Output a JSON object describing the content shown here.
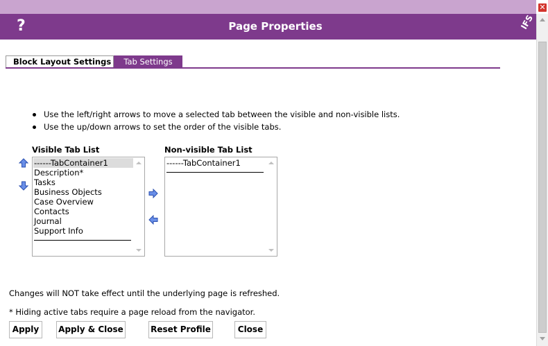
{
  "window": {
    "close_glyph": "✕",
    "title": "Page Properties",
    "help_glyph": "?",
    "logo_text": "IFS"
  },
  "tabs": [
    {
      "label": "Block Layout Settings",
      "active": false
    },
    {
      "label": "Tab Settings",
      "active": true
    }
  ],
  "instructions": [
    "Use the left/right arrows to move a selected tab between the visible and non-visible lists.",
    "Use the up/down arrows to set the order of the visible tabs."
  ],
  "visible_list": {
    "label": "Visible Tab List",
    "items": [
      "------TabContainer1",
      "Description*",
      "Tasks",
      "Business Objects",
      "Case Overview",
      "Contacts",
      "Journal",
      "Support Info"
    ],
    "selected": "------TabContainer1"
  },
  "nonvisible_list": {
    "label": "Non-visible Tab List",
    "items": [
      "------TabContainer1"
    ]
  },
  "icons": {
    "move_up": "arrow-up-icon",
    "move_down": "arrow-down-icon",
    "move_right": "arrow-right-icon",
    "move_left": "arrow-left-icon",
    "arrow_color": "#2a4fb0",
    "arrow_fill": "#6a8fe8"
  },
  "notes": {
    "refresh": "Changes will NOT take effect until the underlying page is refreshed.",
    "reload": "* Hiding active tabs require a page reload from the navigator."
  },
  "buttons": {
    "apply": "Apply",
    "apply_close": "Apply & Close",
    "reset_profile": "Reset Profile",
    "close": "Close"
  },
  "colors": {
    "brand": "#7e3a8c",
    "brand_light": "#c9a4cf",
    "close_red": "#d2342c"
  }
}
